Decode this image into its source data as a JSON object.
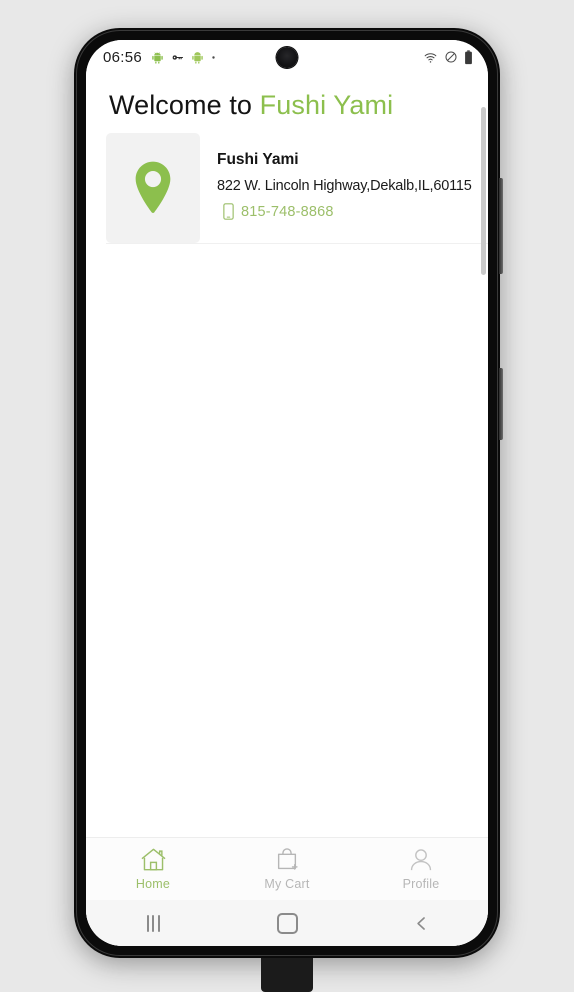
{
  "status_bar": {
    "clock": "06:56",
    "left_icons": [
      "android-icon",
      "key-icon",
      "android-debug-icon",
      "dot-icon"
    ],
    "right_icons": [
      "wifi-icon",
      "do-not-disturb-icon",
      "battery-icon"
    ]
  },
  "header": {
    "welcome_prefix": "Welcome to ",
    "brand_name": "Fushi Yami",
    "brand_color": "#8cbf4d"
  },
  "restaurant_card": {
    "pin_icon": "map-pin-icon",
    "name": "Fushi Yami",
    "address": "822 W. Lincoln Highway,Dekalb,IL,60115",
    "phone_icon": "mobile-phone-icon",
    "phone": "815-748-8868",
    "phone_color": "#9cbf6a"
  },
  "bottom_tabs": {
    "active_index": 0,
    "items": [
      {
        "label": "Home",
        "icon": "house-icon",
        "active": true
      },
      {
        "label": "My Cart",
        "icon": "shopping-bag-plus-icon",
        "active": false
      },
      {
        "label": "Profile",
        "icon": "person-icon",
        "active": false
      }
    ]
  },
  "android_nav": {
    "recents": "recents-icon",
    "home": "home-square-icon",
    "back": "back-chevron-icon"
  }
}
